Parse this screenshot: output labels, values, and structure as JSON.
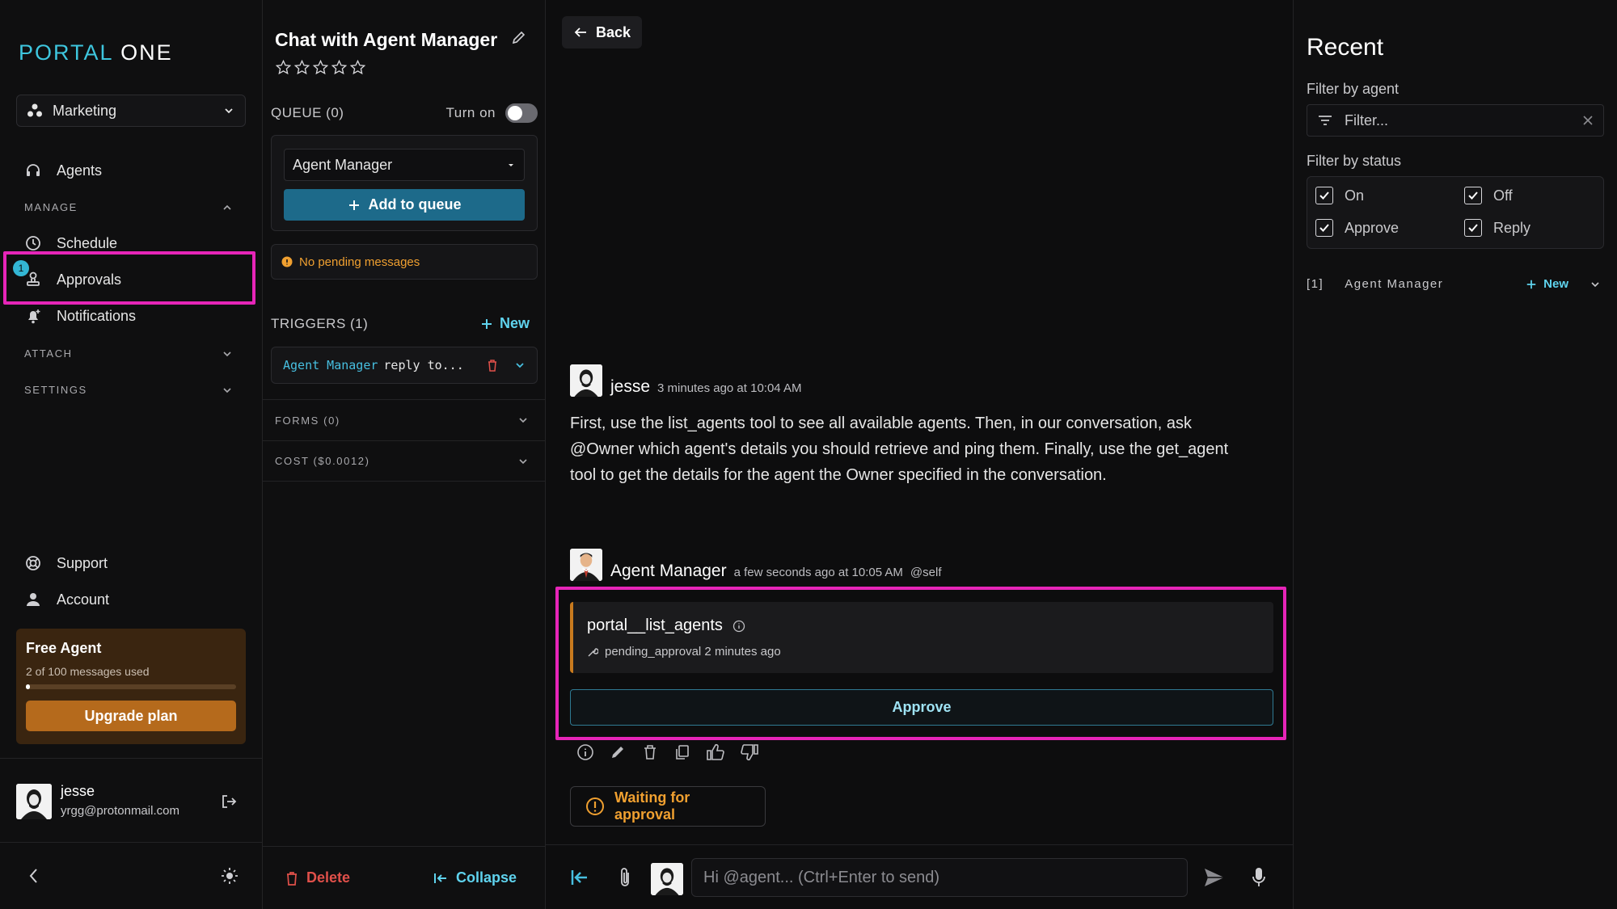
{
  "sidebar": {
    "logo_a": "PORTAL",
    "logo_b": "ONE",
    "workspace": "Marketing",
    "agents": "Agents",
    "manage": "MANAGE",
    "schedule": "Schedule",
    "approvals": "Approvals",
    "approvals_badge": "1",
    "notifications": "Notifications",
    "attach": "ATTACH",
    "settings": "SETTINGS",
    "support": "Support",
    "account": "Account",
    "plan": {
      "title": "Free Agent",
      "usage": "2 of 100 messages used",
      "usage_fraction": 0.02,
      "upgrade": "Upgrade plan"
    },
    "user": {
      "name": "jesse",
      "email": "yrgg@protonmail.com"
    }
  },
  "panel": {
    "title": "Chat with Agent Manager",
    "rating": 0,
    "queue_label": "QUEUE (0)",
    "turn_on": "Turn on",
    "agent_select": "Agent Manager",
    "add_to_queue": "Add to queue",
    "no_pending": "No pending messages",
    "triggers_label": "TRIGGERS (1)",
    "new_label": "New",
    "trigger": {
      "agent": "Agent Manager",
      "text": "reply to..."
    },
    "forms": "FORMS (0)",
    "cost": "COST ($0.0012)",
    "delete": "Delete",
    "collapse": "Collapse"
  },
  "main": {
    "back": "Back",
    "msg1": {
      "author": "jesse",
      "time": "3 minutes ago at 10:04 AM",
      "text": "First, use the list_agents tool to see all available agents. Then, in our conversation, ask @Owner which agent's details you should retrieve and ping them. Finally, use the get_agent tool to get the details for the agent the Owner specified in the conversation."
    },
    "msg2": {
      "author": "Agent Manager",
      "time": "a few seconds ago at 10:05 AM",
      "tag": "@self",
      "tool_name": "portal__list_agents",
      "tool_status": "pending_approval 2 minutes ago",
      "approve": "Approve"
    },
    "waiting": "Waiting for approval",
    "composer_placeholder": "Hi @agent... (Ctrl+Enter to send)"
  },
  "right": {
    "title": "Recent",
    "filter_agent_label": "Filter by agent",
    "filter_placeholder": "Filter...",
    "filter_status_label": "Filter by status",
    "statuses": [
      "On",
      "Off",
      "Approve",
      "Reply"
    ],
    "recent_index": "[1]",
    "recent_agent": "Agent Manager",
    "new_label": "New"
  },
  "colors": {
    "accent_cyan": "#3ec6de",
    "warning_orange": "#f0a030",
    "highlight_magenta": "#e625b8",
    "button_blue": "#1d6a8a"
  }
}
